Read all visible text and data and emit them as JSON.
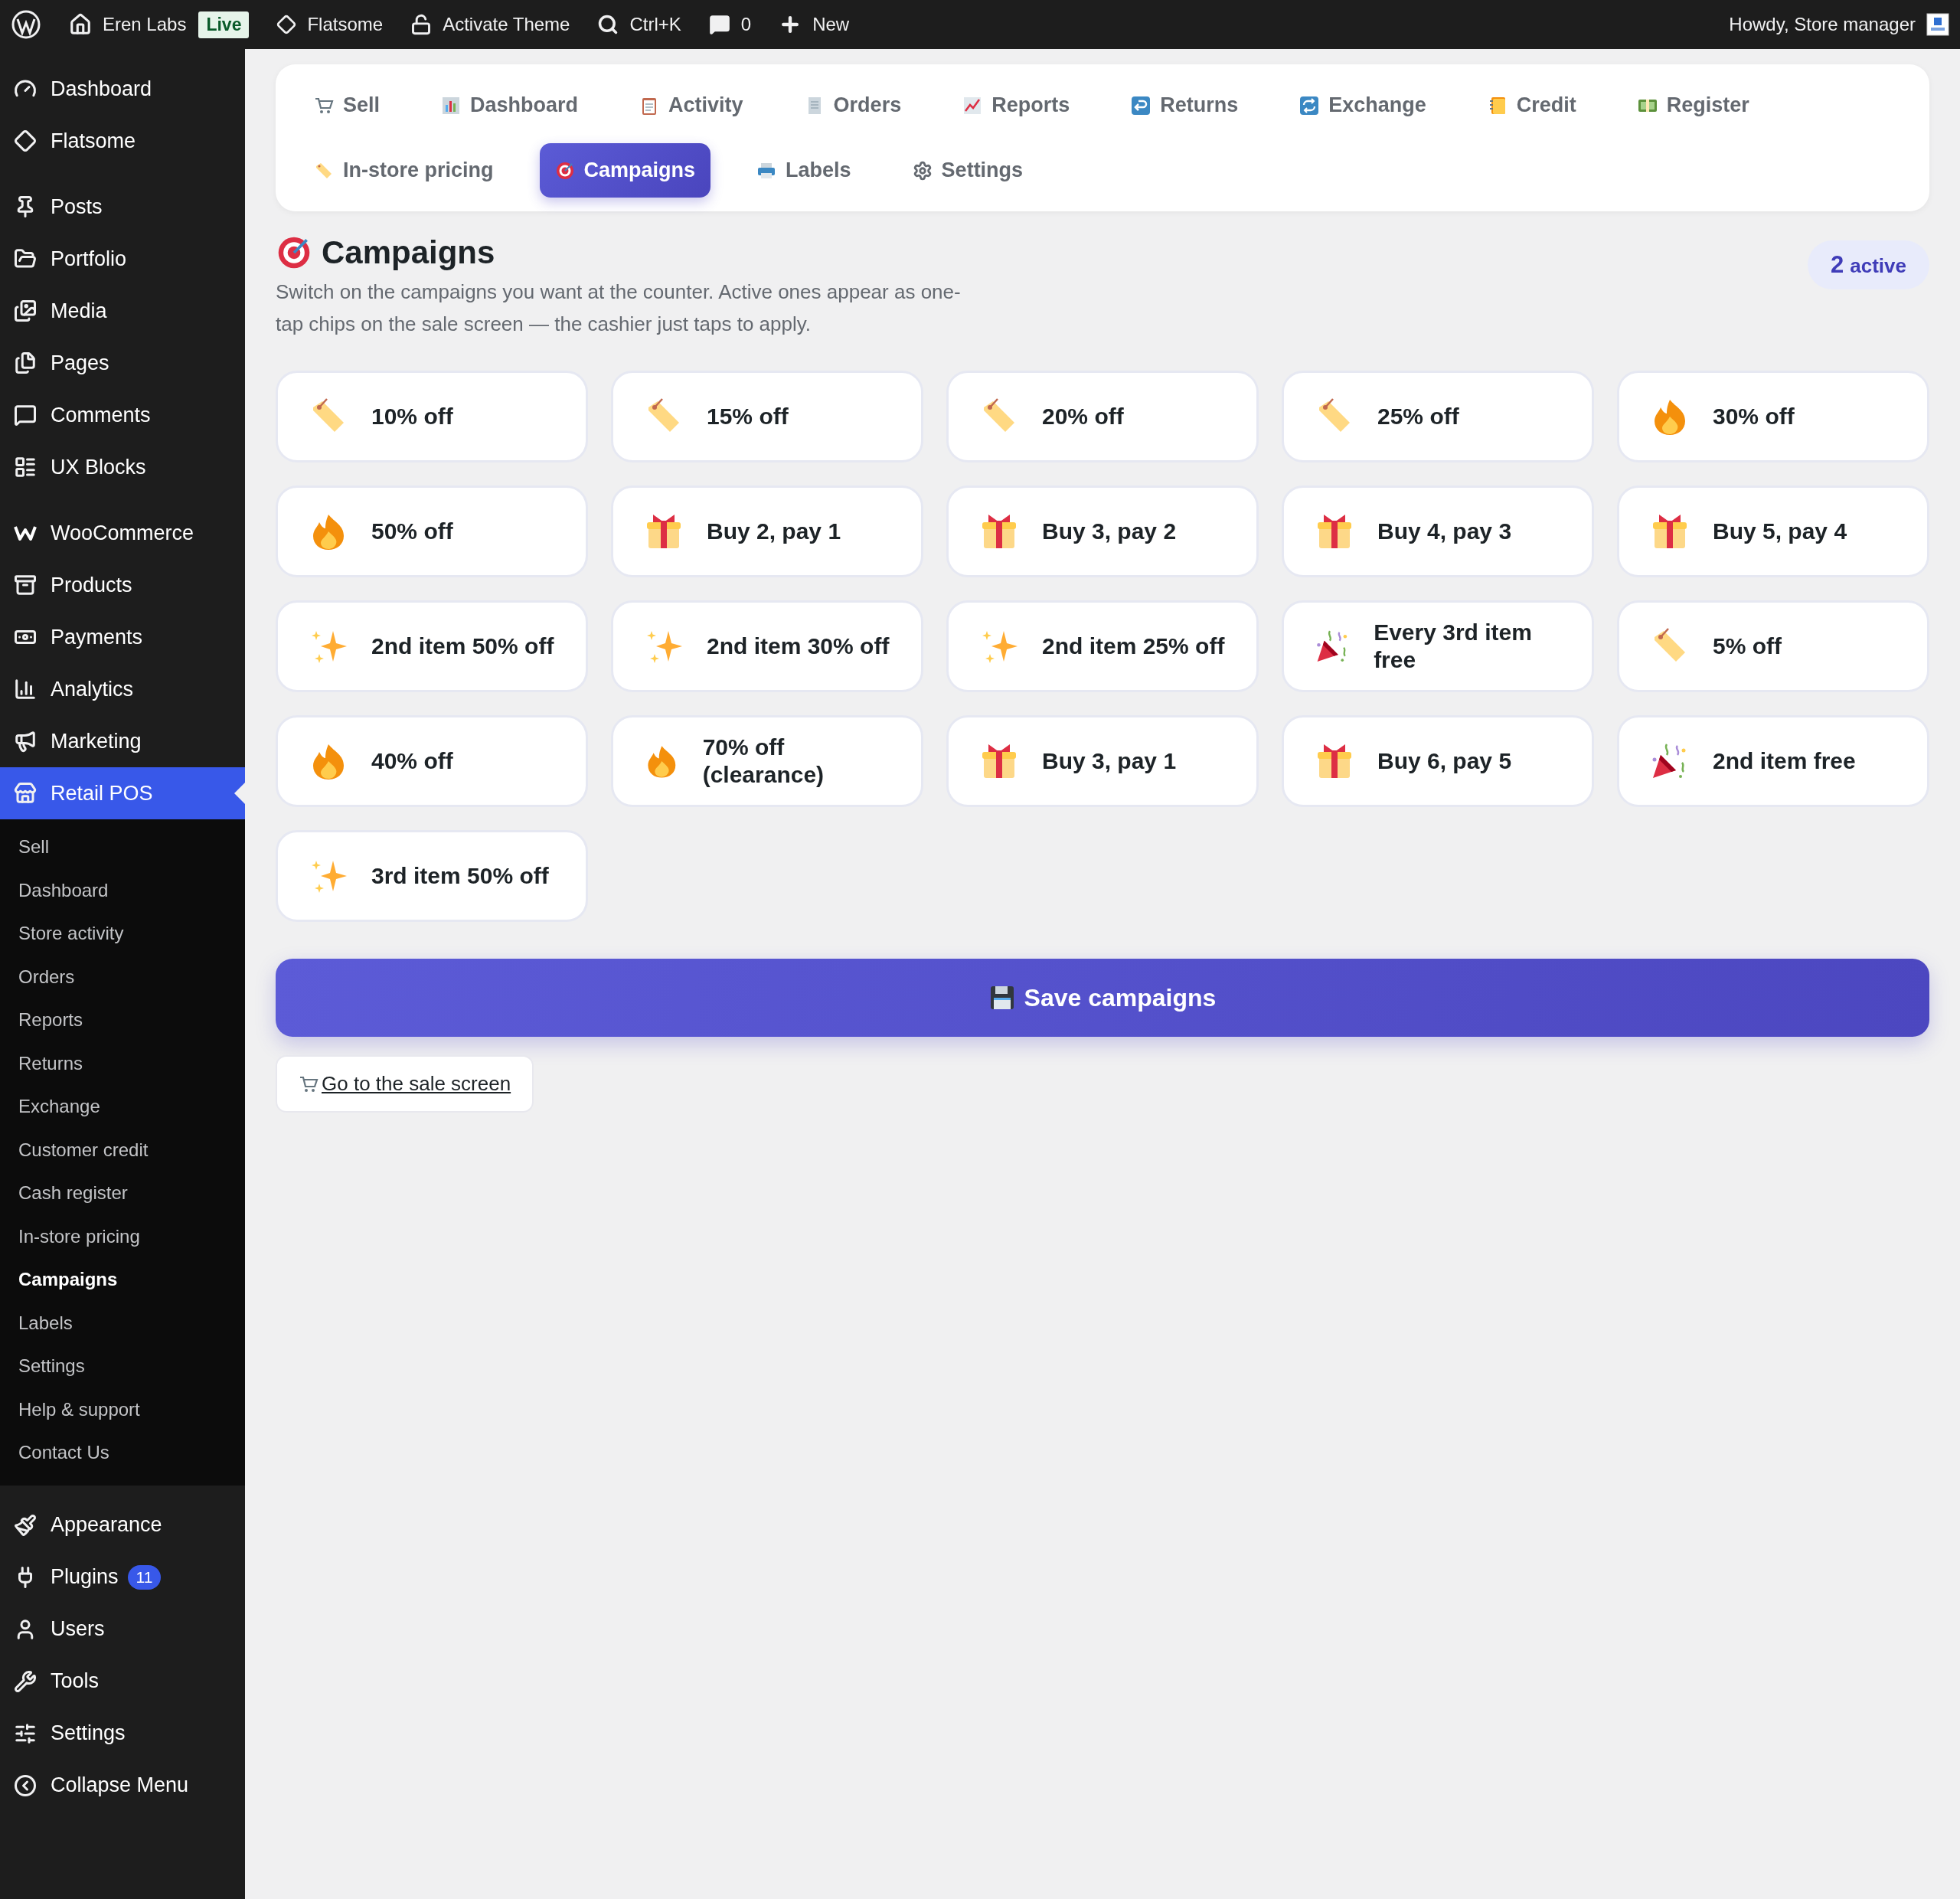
{
  "admin_bar": {
    "items": [
      {
        "kind": "site",
        "label": "Eren Labs"
      },
      {
        "kind": "badge",
        "label": "Live"
      },
      {
        "kind": "theme",
        "label": "Flatsome"
      },
      {
        "kind": "lock",
        "label": "Activate Theme"
      },
      {
        "kind": "search",
        "label": "Ctrl+K"
      },
      {
        "kind": "comments",
        "label": "0"
      },
      {
        "kind": "new",
        "label": "New"
      }
    ],
    "greeting": "Howdy, Store manager"
  },
  "sidebar": {
    "groups": [
      [
        {
          "label": "Dashboard",
          "selected": false
        },
        {
          "label": "Flatsome",
          "selected": false
        }
      ],
      [
        {
          "label": "Posts",
          "selected": false
        },
        {
          "label": "Portfolio",
          "selected": false
        },
        {
          "label": "Media",
          "selected": false
        },
        {
          "label": "Pages",
          "selected": false
        },
        {
          "label": "Comments",
          "selected": false
        },
        {
          "label": "UX Blocks",
          "selected": false
        }
      ],
      [
        {
          "label": "WooCommerce",
          "selected": false
        },
        {
          "label": "Products",
          "selected": false
        },
        {
          "label": "Payments",
          "selected": false
        },
        {
          "label": "Analytics",
          "selected": false
        },
        {
          "label": "Marketing",
          "selected": false
        },
        {
          "label": "Retail POS",
          "selected": true,
          "submenu": [
            {
              "label": "Sell",
              "selected": false
            },
            {
              "label": "Dashboard",
              "selected": false
            },
            {
              "label": "Store activity",
              "selected": false
            },
            {
              "label": "Orders",
              "selected": false
            },
            {
              "label": "Reports",
              "selected": false
            },
            {
              "label": "Returns",
              "selected": false
            },
            {
              "label": "Exchange",
              "selected": false
            },
            {
              "label": "Customer credit",
              "selected": false
            },
            {
              "label": "Cash register",
              "selected": false
            },
            {
              "label": "In-store pricing",
              "selected": false
            },
            {
              "label": "Campaigns",
              "selected": true
            },
            {
              "label": "Labels",
              "selected": false
            },
            {
              "label": "Settings",
              "selected": false
            },
            {
              "label": "Help & support",
              "selected": false
            },
            {
              "label": "Contact Us",
              "selected": false
            }
          ]
        }
      ],
      [
        {
          "label": "Appearance",
          "selected": false
        },
        {
          "label": "Plugins",
          "selected": false,
          "badge": "11"
        },
        {
          "label": "Users",
          "selected": false
        },
        {
          "label": "Tools",
          "selected": false
        },
        {
          "label": "Settings",
          "selected": false
        },
        {
          "label": "Collapse Menu",
          "selected": false
        }
      ]
    ]
  },
  "tab_rows": [
    [
      {
        "label": "Sell",
        "selected": false
      },
      {
        "label": "Dashboard",
        "selected": false
      },
      {
        "label": "Activity",
        "selected": false
      },
      {
        "label": "Orders",
        "selected": false
      },
      {
        "label": "Reports",
        "selected": false
      },
      {
        "label": "Returns",
        "selected": false
      },
      {
        "label": "Exchange",
        "selected": false
      },
      {
        "label": "Credit",
        "selected": false
      },
      {
        "label": "Register",
        "selected": false
      }
    ],
    [
      {
        "label": "In-store pricing",
        "selected": false
      },
      {
        "label": "Campaigns",
        "selected": true
      },
      {
        "label": "Labels",
        "selected": false
      },
      {
        "label": "Settings",
        "selected": false
      }
    ]
  ],
  "page": {
    "title": "Campaigns",
    "description": "Switch on the campaigns you want at the counter. Active ones appear as one-tap chips on the sale screen — the cashier just taps to apply.",
    "active_count": "2",
    "active_label": "active"
  },
  "campaigns": [
    {
      "label": "10% off",
      "kind": "tag"
    },
    {
      "label": "15% off",
      "kind": "tag"
    },
    {
      "label": "20% off",
      "kind": "tag"
    },
    {
      "label": "25% off",
      "kind": "tag"
    },
    {
      "label": "30% off",
      "kind": "fire"
    },
    {
      "label": "50% off",
      "kind": "fire"
    },
    {
      "label": "Buy 2, pay 1",
      "kind": "gift"
    },
    {
      "label": "Buy 3, pay 2",
      "kind": "gift"
    },
    {
      "label": "Buy 4, pay 3",
      "kind": "gift"
    },
    {
      "label": "Buy 5, pay 4",
      "kind": "gift"
    },
    {
      "label": "2nd item 50% off",
      "kind": "sparkle"
    },
    {
      "label": "2nd item 30% off",
      "kind": "sparkle"
    },
    {
      "label": "2nd item 25% off",
      "kind": "sparkle"
    },
    {
      "label": "Every 3rd item free",
      "kind": "party"
    },
    {
      "label": "5% off",
      "kind": "tag"
    },
    {
      "label": "40% off",
      "kind": "fire"
    },
    {
      "label": "70% off (clearance)",
      "kind": "fire"
    },
    {
      "label": "Buy 3, pay 1",
      "kind": "gift"
    },
    {
      "label": "Buy 6, pay 5",
      "kind": "gift"
    },
    {
      "label": "2nd item free",
      "kind": "party"
    },
    {
      "label": "3rd item 50% off",
      "kind": "sparkle"
    }
  ],
  "save_button": "Save campaigns",
  "sale_link": "Go to the sale screen"
}
